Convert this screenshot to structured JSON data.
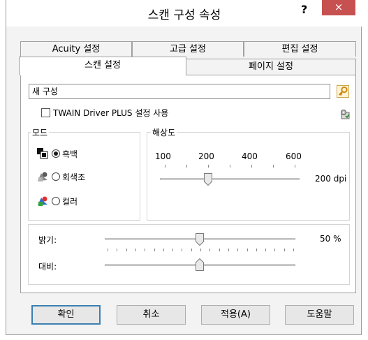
{
  "window": {
    "title": "스캔 구성 속성",
    "help_label": "?",
    "close_label": "×"
  },
  "tabs_back": [
    "Acuity 설정",
    "고급 설정",
    "편집 설정"
  ],
  "tabs_front": [
    "스캔 설정",
    "페이지 설정"
  ],
  "config_name": {
    "value": "새 구성"
  },
  "twain": {
    "label": "TWAIN Driver PLUS 설정 사용",
    "checked": false
  },
  "mode": {
    "title": "모드",
    "options": [
      {
        "label": "흑백",
        "selected": true
      },
      {
        "label": "회색조",
        "selected": false
      },
      {
        "label": "컬러",
        "selected": false
      }
    ]
  },
  "resolution": {
    "title": "해상도",
    "ticks": [
      "100",
      "200",
      "400",
      "600"
    ],
    "value_label": "200 dpi"
  },
  "brightness": {
    "label": "밝기:",
    "value_label": "50 %",
    "value": 50
  },
  "contrast": {
    "label": "대비:",
    "value": 50
  },
  "buttons": {
    "ok": "확인",
    "cancel": "취소",
    "apply": "적용(A)",
    "help": "도움말"
  },
  "colors": {
    "close_red": "#c75050",
    "default_button_border": "#3c7fb1"
  }
}
